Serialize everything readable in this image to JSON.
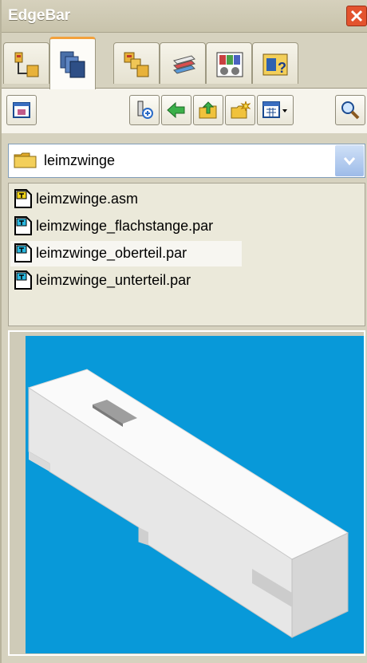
{
  "window": {
    "title": "EdgeBar"
  },
  "tabs": [
    {
      "name": "feature-pathfinder-tab-icon"
    },
    {
      "name": "part-library-tab-icon",
      "active": true
    },
    {
      "name": "assembly-pathfinder-tab-icon"
    },
    {
      "name": "layers-tab-icon"
    },
    {
      "name": "color-manager-tab-icon"
    },
    {
      "name": "help-tab-icon"
    }
  ],
  "toolbar": {
    "buttons": [
      "new-window-icon",
      "select-tool-icon",
      "back-arrow-icon",
      "up-folder-icon",
      "new-folder-icon",
      "view-options-icon",
      "search-icon"
    ]
  },
  "folder": {
    "current": "leimzwinge"
  },
  "files": [
    {
      "label": "leimzwinge.asm",
      "type": "asm"
    },
    {
      "label": "leimzwinge_flachstange.par",
      "type": "par"
    },
    {
      "label": "leimzwinge_oberteil.par",
      "type": "par",
      "hover": true
    },
    {
      "label": "leimzwinge_unterteil.par",
      "type": "par"
    }
  ],
  "colors": {
    "preview_background": "#0899d9",
    "active_tab_accent": "#f3a13c"
  }
}
